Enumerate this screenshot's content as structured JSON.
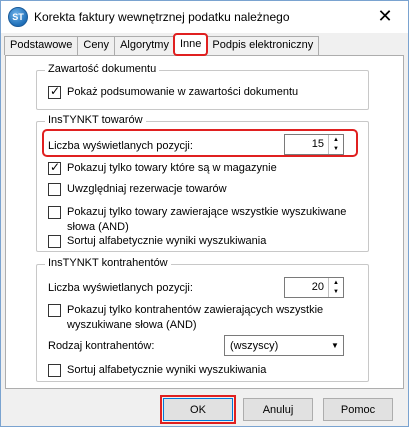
{
  "window": {
    "title": "Korekta faktury wewnętrznej podatku należnego",
    "icon_text": "ST",
    "close_glyph": "✕"
  },
  "tabs": [
    {
      "label": "Podstawowe"
    },
    {
      "label": "Ceny"
    },
    {
      "label": "Algorytmy"
    },
    {
      "label": "Inne",
      "active": true
    },
    {
      "label": "Podpis elektroniczny"
    }
  ],
  "doc_group": {
    "title": "Zawartość dokumentu",
    "show_summary": {
      "label": "Pokaż podsumowanie w zawartości dokumentu",
      "checked": true
    }
  },
  "goods_group": {
    "title": "InsTYNKT towarów",
    "count_label": "Liczba wyświetlanych pozycji:",
    "count_value": "15",
    "options": [
      {
        "label": "Pokazuj tylko towary które są w magazynie",
        "checked": true
      },
      {
        "label": "Uwzględniaj rezerwacje towarów",
        "checked": false
      },
      {
        "label": "Pokazuj tylko towary zawierające wszystkie wyszukiwane słowa (AND)",
        "checked": false
      },
      {
        "label": "Sortuj alfabetycznie wyniki wyszukiwania",
        "checked": false
      }
    ]
  },
  "contractors_group": {
    "title": "InsTYNKT kontrahentów",
    "count_label": "Liczba wyświetlanych pozycji:",
    "count_value": "20",
    "only_all_words": {
      "label": "Pokazuj tylko kontrahentów zawierających wszystkie wyszukiwane słowa (AND)",
      "checked": false
    },
    "type_label": "Rodzaj kontrahentów:",
    "type_value": "(wszyscy)",
    "sort_alpha": {
      "label": "Sortuj alfabetycznie wyniki wyszukiwania",
      "checked": false
    }
  },
  "buttons": {
    "ok": "OK",
    "cancel": "Anuluj",
    "help": "Pomoc"
  },
  "colors": {
    "highlight": "#e02020",
    "accent": "#0078d7"
  }
}
